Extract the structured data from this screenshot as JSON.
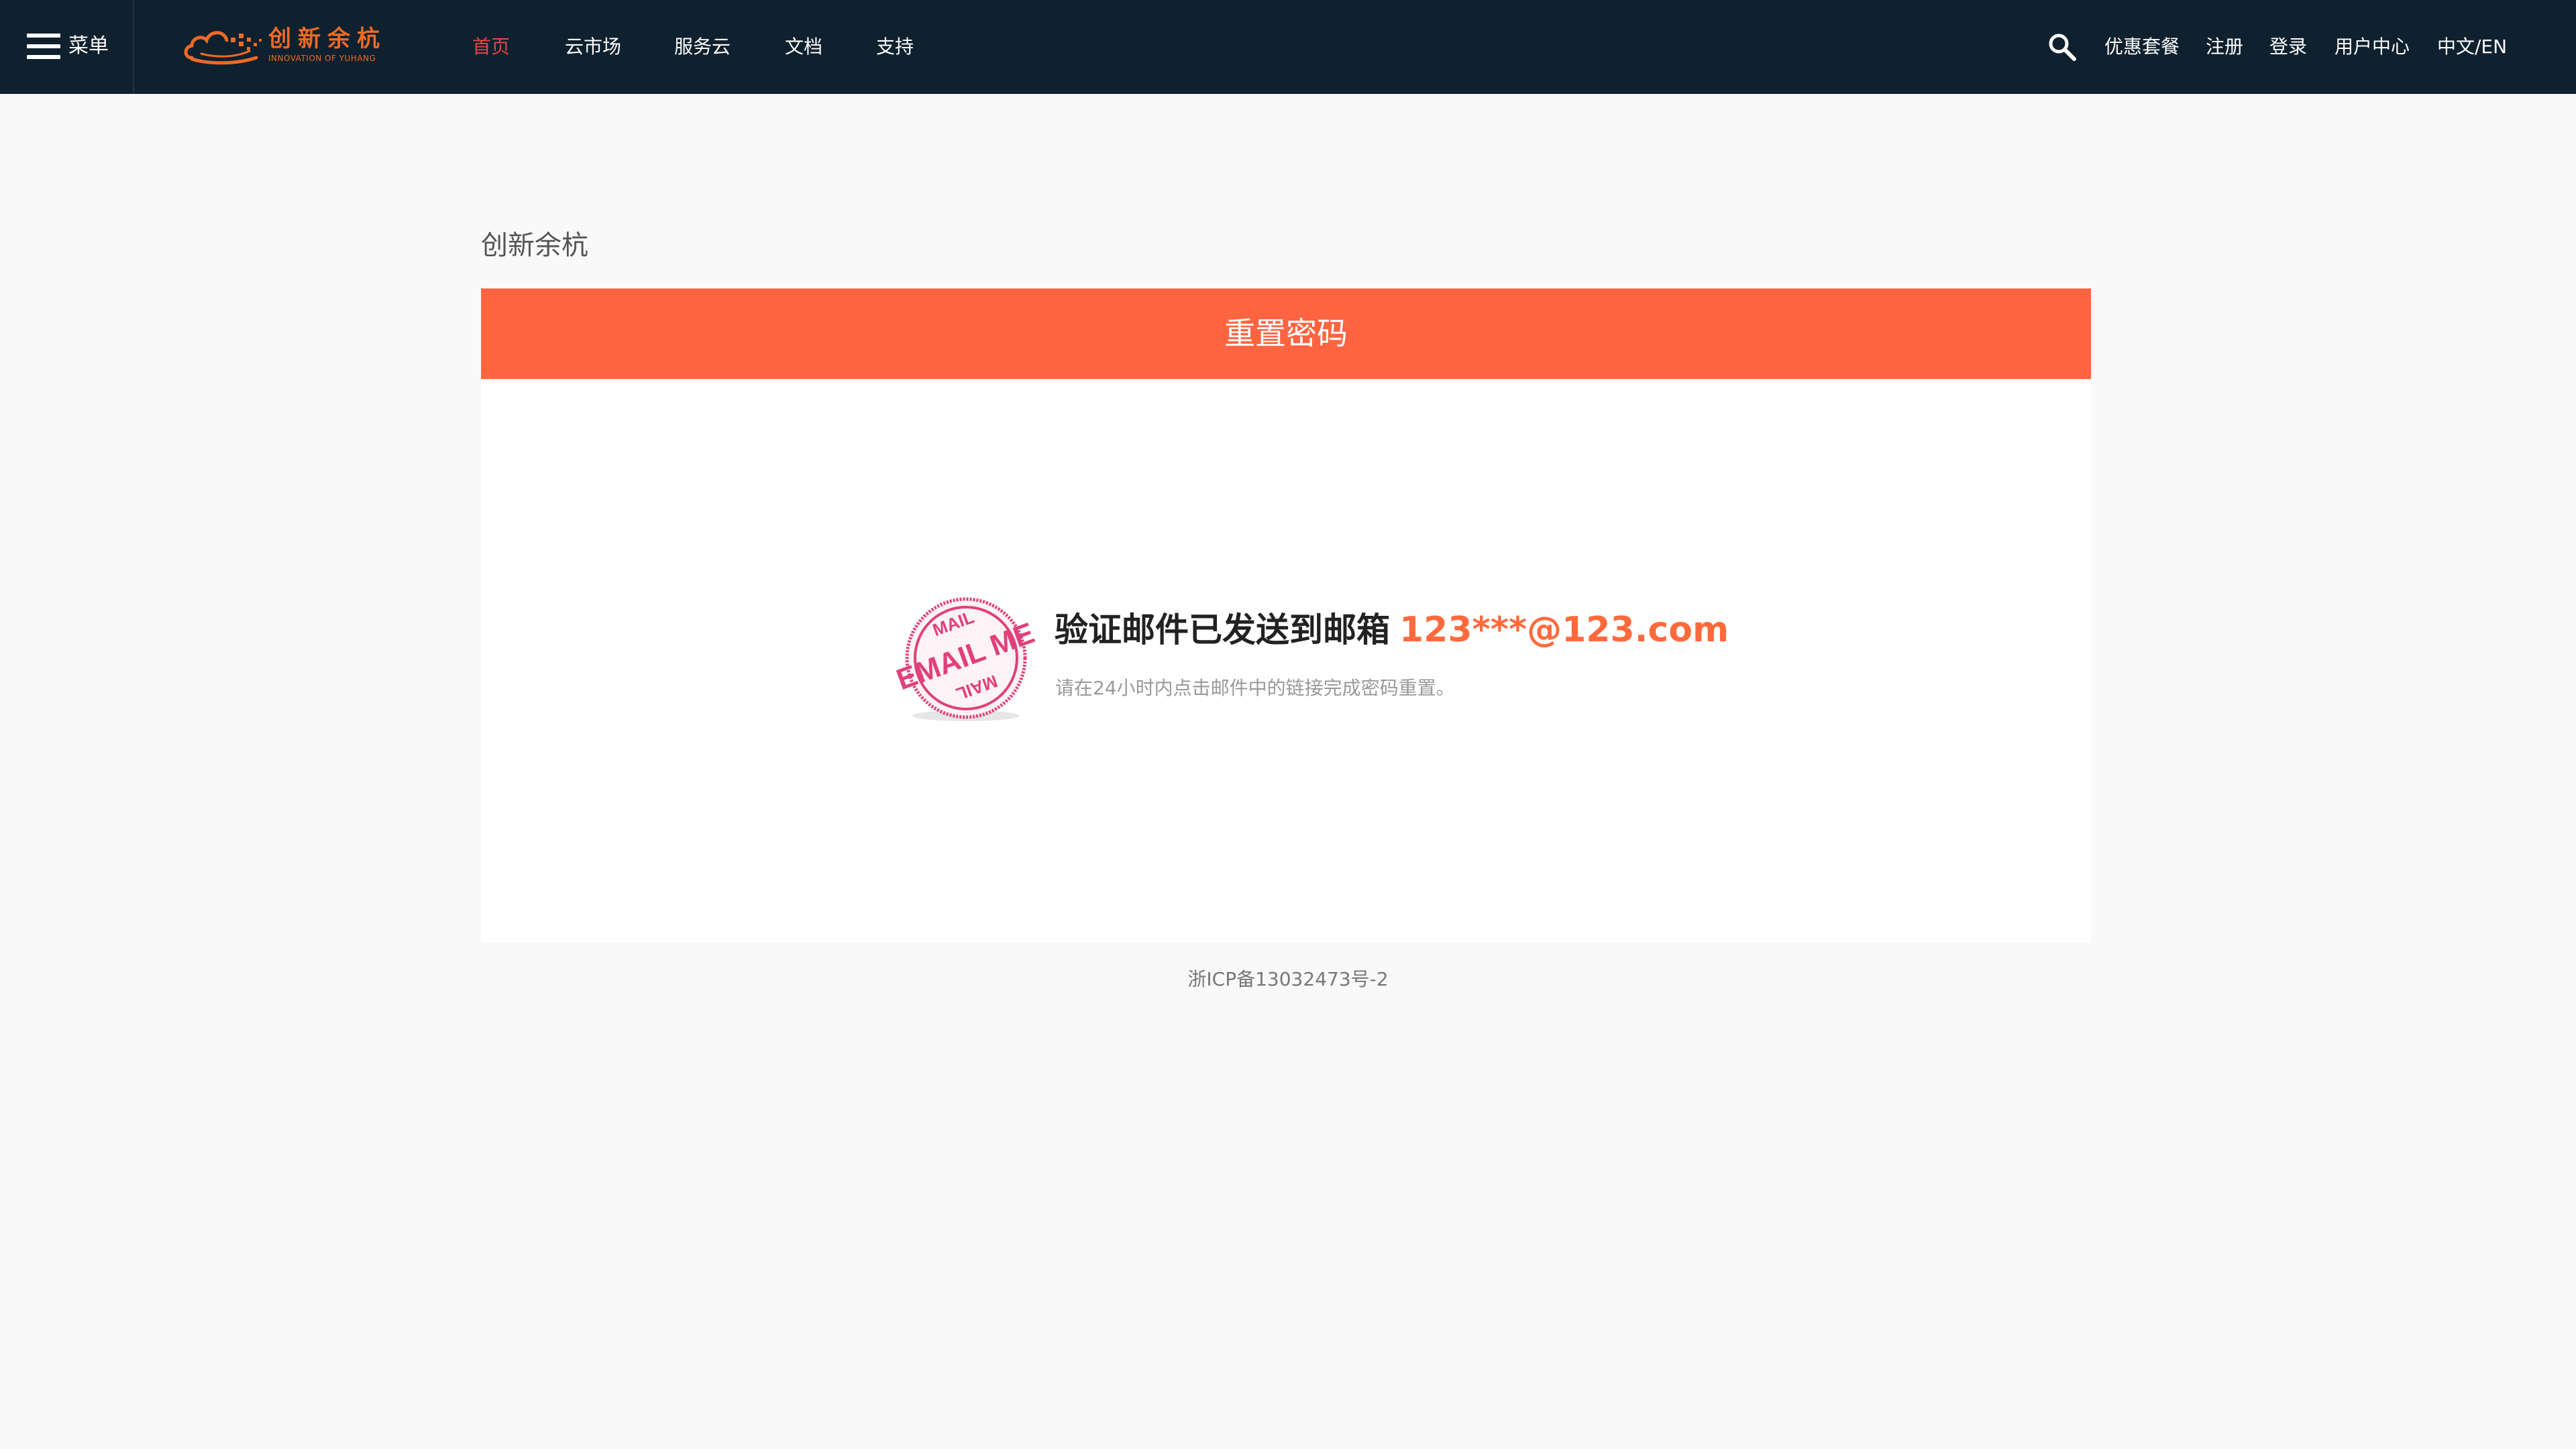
{
  "header": {
    "menu_label": "菜单",
    "logo_title": "创新余杭",
    "logo_subtitle": "INNOVATION OF YUHANG",
    "nav": [
      "首页",
      "云市场",
      "服务云",
      "文档",
      "支持"
    ],
    "active_nav": "首页",
    "right_links": [
      "优惠套餐",
      "注册",
      "登录",
      "用户中心",
      "中文/EN"
    ],
    "search_icon": "search-icon"
  },
  "main": {
    "brand": "创新余杭",
    "panel_title": "重置密码",
    "notice": "验证邮件已发送到邮箱",
    "email": "123***@123.com",
    "hint": "请在24小时内点击邮件中的链接完成密码重置。",
    "stamp_top": "MAIL",
    "stamp_center": "EMAIL ME",
    "stamp_bottom": "MAIL"
  },
  "footer": {
    "icp": "浙ICP备13032473号-2"
  },
  "colors": {
    "topbar": "#0f202e",
    "accent": "#ff6440",
    "active_nav": "#e8454a",
    "logo": "#ef6a26",
    "stamp": "#e0417a"
  }
}
